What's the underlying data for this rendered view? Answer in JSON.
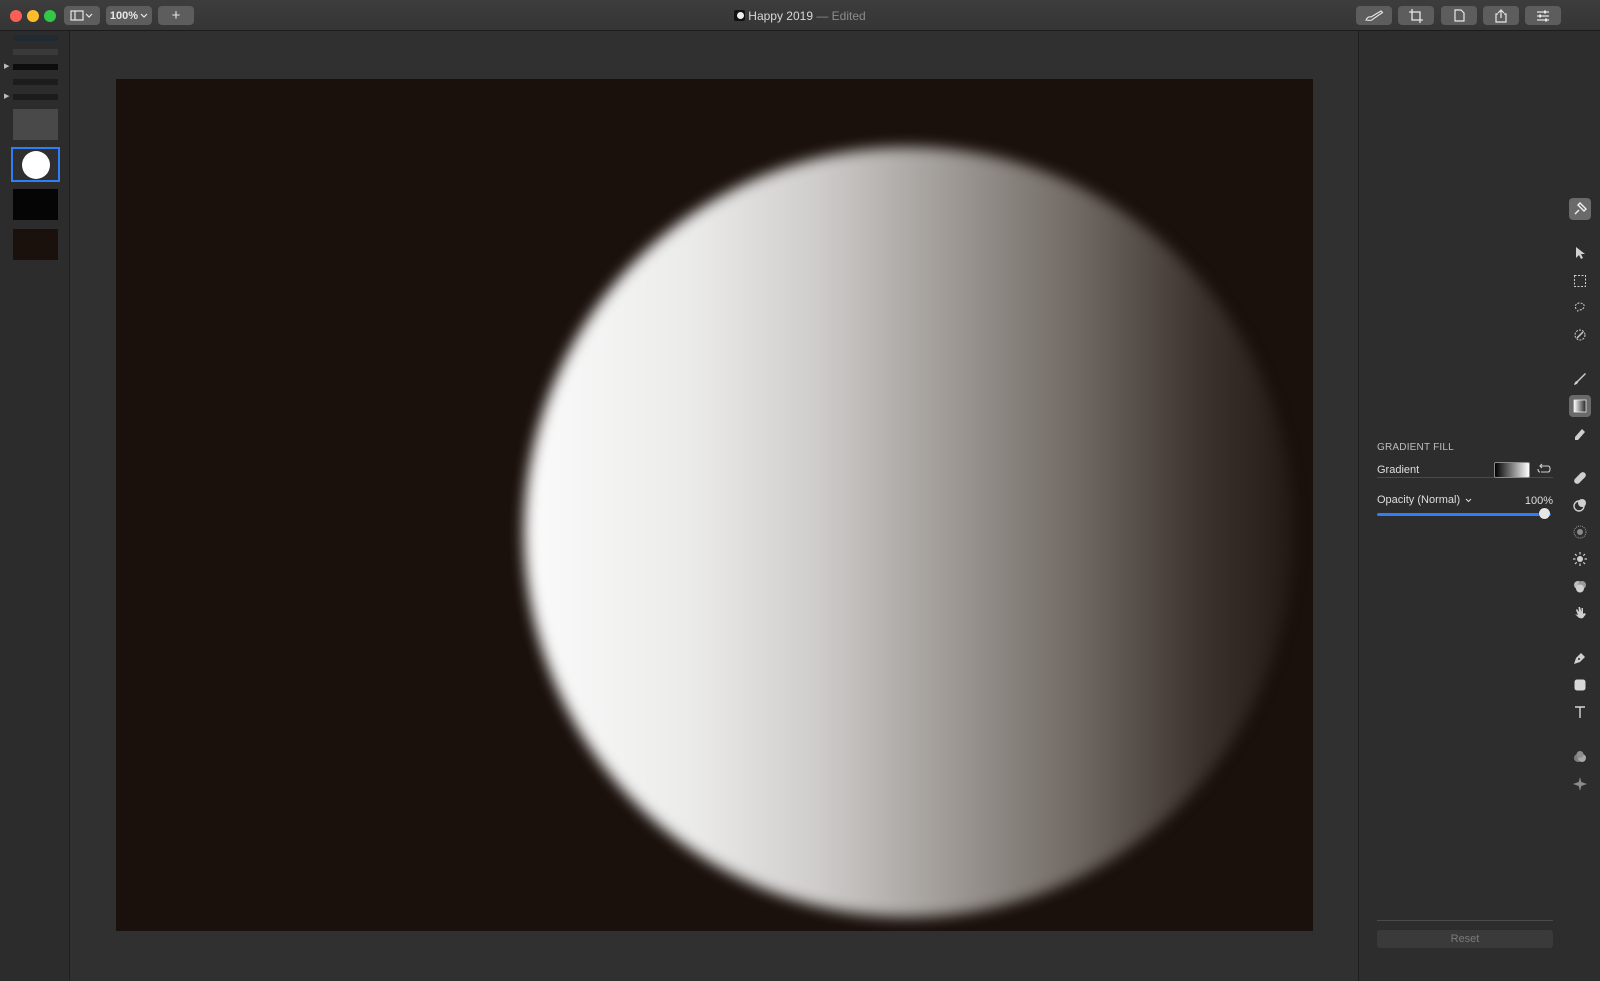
{
  "window": {
    "title": "Happy 2019",
    "title_suffix": " — Edited",
    "zoom_label": "100%",
    "add_label": "+"
  },
  "toolbar_icons": [
    "sidebar-toggle-icon",
    "brush-icon",
    "crop-icon",
    "document-icon",
    "share-icon",
    "adjustments-icon"
  ],
  "layers": {
    "items": [
      {
        "name": "group-layer-1"
      },
      {
        "name": "text-layer"
      },
      {
        "name": "group-layer-2",
        "collapsed": true
      },
      {
        "name": "group-layer-3"
      },
      {
        "name": "group-layer-4",
        "collapsed": true
      },
      {
        "name": "gray-layer"
      },
      {
        "name": "circle-layer",
        "selected": true
      },
      {
        "name": "black-layer"
      },
      {
        "name": "background-layer"
      }
    ]
  },
  "inspector": {
    "section_title": "GRADIENT FILL",
    "gradient_label": "Gradient",
    "opacity_label": "Opacity (Normal)",
    "opacity_value": "100%",
    "opacity_level": 1.0,
    "reset_label": "Reset"
  },
  "tools": [
    "arrange-tool",
    "move-tool",
    "rect-select-tool",
    "lasso-tool",
    "magic-select-tool",
    "paint-brush-tool",
    "gradient-fill-tool",
    "eraser-tool",
    "retouch-tool",
    "clone-tool",
    "blur-tool",
    "lighten-tool",
    "color-tool",
    "smudge-tool",
    "pen-tool",
    "shape-tool",
    "text-tool",
    "effects-tool",
    "sparkle-tool"
  ],
  "colors": {
    "accent": "#2f7ef5",
    "canvas_background": "#1a100c",
    "selection_border": "#2f7ef5"
  }
}
